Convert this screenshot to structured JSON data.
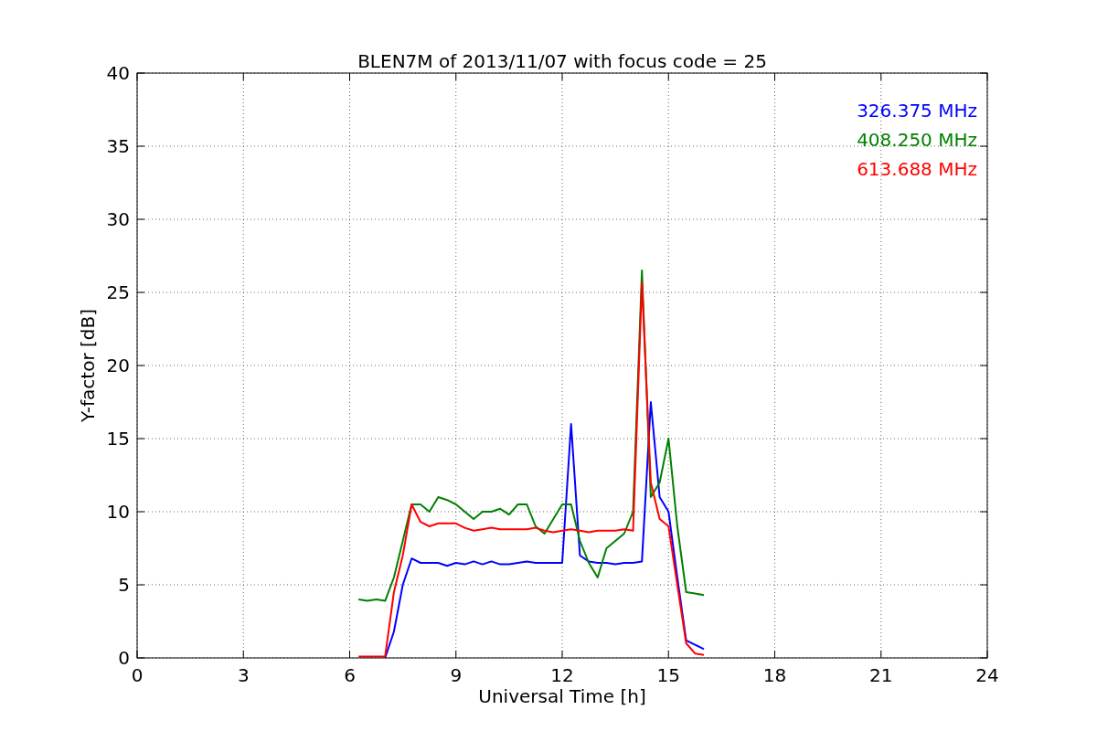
{
  "chart_data": {
    "type": "line",
    "title": "BLEN7M of 2013/11/07 with focus code = 25",
    "xlabel": "Universal Time [h]",
    "ylabel": "Y-factor [dB]",
    "x": [
      6.25,
      6.5,
      6.75,
      7,
      7.25,
      7.5,
      7.75,
      8,
      8.25,
      8.5,
      8.75,
      9,
      9.25,
      9.5,
      9.75,
      10,
      10.25,
      10.5,
      10.75,
      11,
      11.25,
      11.5,
      11.75,
      12,
      12.25,
      12.5,
      12.75,
      13,
      13.25,
      13.5,
      13.75,
      14,
      14.25,
      14.5,
      14.75,
      15,
      15.25,
      15.5,
      15.75,
      16
    ],
    "series": [
      {
        "name": "326.375 MHz",
        "color": "#0000ff",
        "values": [
          null,
          null,
          null,
          0,
          1.8,
          5,
          6.8,
          6.5,
          6.5,
          6.5,
          6.3,
          6.5,
          6.4,
          6.6,
          6.4,
          6.6,
          6.4,
          6.4,
          6.5,
          6.6,
          6.5,
          6.5,
          6.5,
          6.5,
          16,
          7,
          6.6,
          6.5,
          6.5,
          6.4,
          6.5,
          6.5,
          6.6,
          17.5,
          11,
          10,
          5.5,
          1.2,
          0.9,
          0.6
        ]
      },
      {
        "name": "408.250 MHz",
        "color": "#008000",
        "values": [
          4,
          3.9,
          4,
          3.9,
          5.5,
          8,
          10.5,
          10.5,
          10,
          11,
          10.8,
          10.5,
          10,
          9.5,
          10,
          10,
          10.2,
          9.8,
          10.5,
          10.5,
          9,
          8.5,
          9.5,
          10.5,
          10.5,
          8,
          6.5,
          5.5,
          7.5,
          8,
          8.5,
          10,
          26.5,
          11,
          12,
          15,
          9,
          4.5,
          4.4,
          4.3
        ]
      },
      {
        "name": "613.688 MHz",
        "color": "#ff0000",
        "values": [
          0.1,
          0.1,
          0.1,
          0.1,
          4.5,
          7,
          10.5,
          9.3,
          9,
          9.2,
          9.2,
          9.2,
          8.9,
          8.7,
          8.8,
          8.9,
          8.8,
          8.8,
          8.8,
          8.8,
          8.9,
          8.7,
          8.6,
          8.7,
          8.8,
          8.7,
          8.6,
          8.7,
          8.7,
          8.7,
          8.8,
          8.7,
          25.7,
          12,
          9.5,
          9,
          5,
          1,
          0.3,
          0.2
        ]
      }
    ],
    "xlim": [
      0,
      24
    ],
    "ylim": [
      0,
      40
    ],
    "xticks": [
      0,
      3,
      6,
      9,
      12,
      15,
      18,
      21,
      24
    ],
    "yticks": [
      0,
      5,
      10,
      15,
      20,
      25,
      30,
      35,
      40
    ],
    "grid": true
  }
}
